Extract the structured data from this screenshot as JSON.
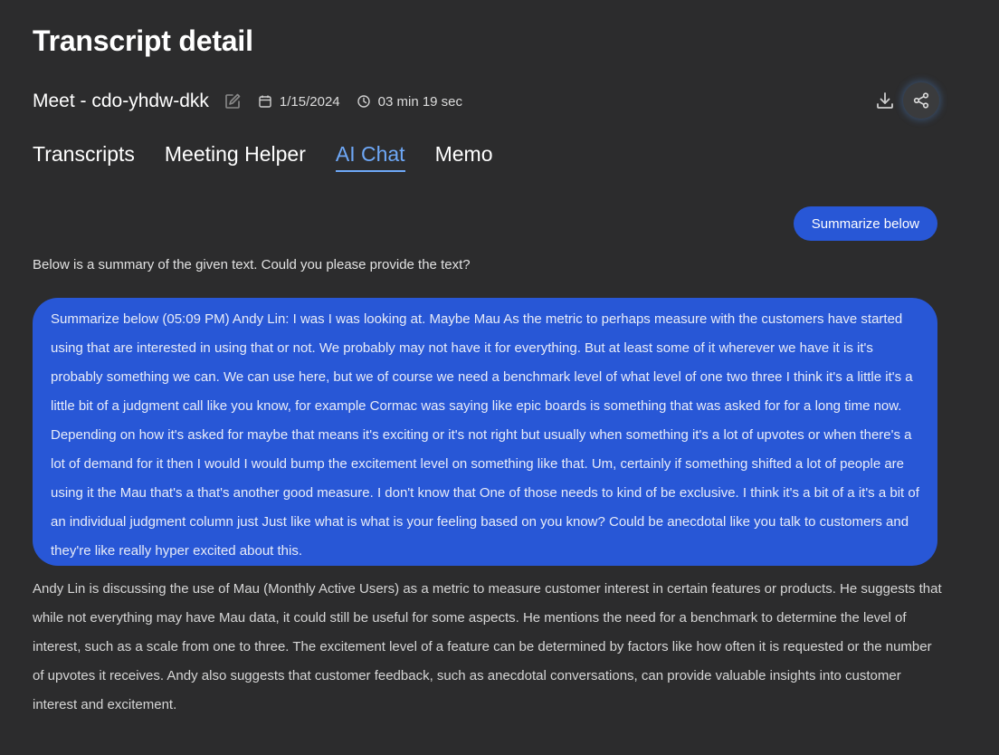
{
  "page": {
    "title": "Transcript detail"
  },
  "meeting": {
    "name": "Meet - cdo-yhdw-dkk",
    "date": "1/15/2024",
    "duration": "03 min 19 sec"
  },
  "icons": {
    "edit": "pencil-edit-icon",
    "calendar": "calendar-icon",
    "clock": "clock-icon",
    "download": "download-icon",
    "share": "share-icon"
  },
  "tabs": [
    {
      "label": "Transcripts",
      "active": false
    },
    {
      "label": "Meeting Helper",
      "active": false
    },
    {
      "label": "AI Chat",
      "active": true
    },
    {
      "label": "Memo",
      "active": false
    }
  ],
  "chat": {
    "prompt_chip": "Summarize below",
    "first_reply": "Below is a summary of the given text. Could you please provide the text?",
    "user_message": "Summarize below (05:09 PM) Andy Lin: I was I was looking at. Maybe Mau As the metric to perhaps measure with the customers have started using that are interested in using that or not. We probably may not have it for everything. But at least some of it wherever we have it is it's probably something we can. We can use here, but we of course we need a benchmark level of what level of one two three I think it's a little it's a little bit of a judgment call like you know, for example Cormac was saying like epic boards is something that was asked for for a long time now. Depending on how it's asked for maybe that means it's exciting or it's not right but usually when something it's a lot of upvotes or when there's a lot of demand for it then I would I would bump the excitement level on something like that. Um, certainly if something shifted a lot of people are using it the Mau that's a that's another good measure. I don't know that One of those needs to kind of be exclusive. I think it's a bit of a it's a bit of an individual judgment column just Just like what is what is your feeling based on you know? Could be anecdotal like you talk to customers and they're like really hyper excited about this.",
    "ai_answer": "Andy Lin is discussing the use of Mau (Monthly Active Users) as a metric to measure customer interest in certain features or products. He suggests that while not everything may have Mau data, it could still be useful for some aspects. He mentions the need for a benchmark to determine the level of interest, such as a scale from one to three. The excitement level of a feature can be determined by factors like how often it is requested or the number of upvotes it receives. Andy also suggests that customer feedback, such as anecdotal conversations, can provide valuable insights into customer interest and excitement."
  },
  "colors": {
    "background": "#2c2c2d",
    "accent_blue": "#2857d6",
    "active_tab": "#6ea8f7"
  }
}
